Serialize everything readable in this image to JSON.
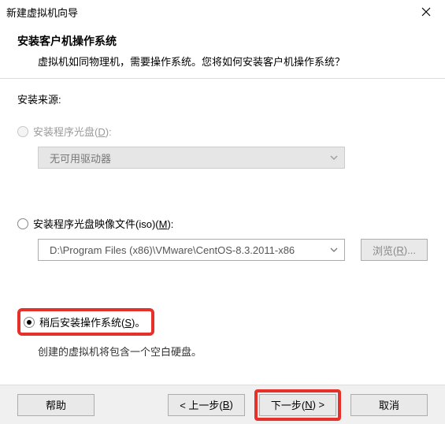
{
  "titlebar": {
    "title": "新建虚拟机向导"
  },
  "header": {
    "heading": "安装客户机操作系统",
    "desc": "虚拟机如同物理机，需要操作系统。您将如何安装客户机操作系统？"
  },
  "source_label": "安装来源:",
  "option_disc": {
    "prefix": "安装程序光盘(",
    "key": "D",
    "suffix": "):",
    "dropdown_text": "无可用驱动器"
  },
  "option_iso": {
    "prefix": "安装程序光盘映像文件(iso)(",
    "key": "M",
    "suffix": "):",
    "path": "D:\\Program Files (x86)\\VMware\\CentOS-8.3.2011-x86",
    "browse_prefix": "浏览(",
    "browse_key": "R",
    "browse_suffix": ")..."
  },
  "option_later": {
    "prefix": "稍后安装操作系统(",
    "key": "S",
    "suffix": ")。",
    "hint": "创建的虚拟机将包含一个空白硬盘。"
  },
  "footer": {
    "help": "帮助",
    "back_prefix": "< 上一步(",
    "back_key": "B",
    "back_suffix": ")",
    "next_prefix": "下一步(",
    "next_key": "N",
    "next_suffix": ") >",
    "cancel": "取消"
  }
}
